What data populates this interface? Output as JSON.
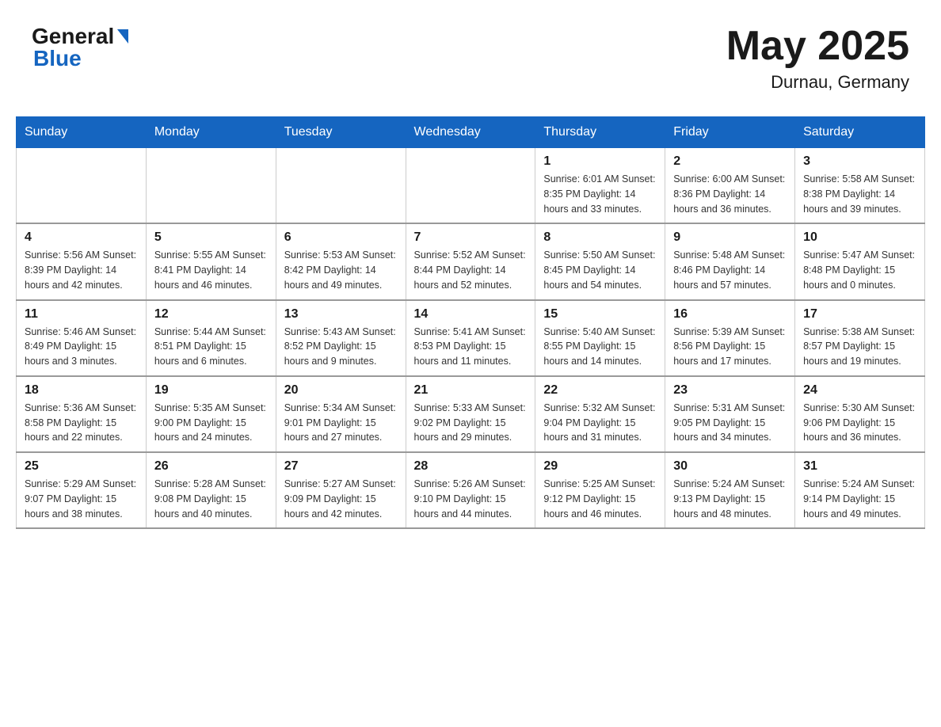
{
  "header": {
    "logo_general": "General",
    "logo_blue": "Blue",
    "month_year": "May 2025",
    "location": "Durnau, Germany"
  },
  "calendar": {
    "days_of_week": [
      "Sunday",
      "Monday",
      "Tuesday",
      "Wednesday",
      "Thursday",
      "Friday",
      "Saturday"
    ],
    "weeks": [
      [
        {
          "day": "",
          "info": ""
        },
        {
          "day": "",
          "info": ""
        },
        {
          "day": "",
          "info": ""
        },
        {
          "day": "",
          "info": ""
        },
        {
          "day": "1",
          "info": "Sunrise: 6:01 AM\nSunset: 8:35 PM\nDaylight: 14 hours and 33 minutes."
        },
        {
          "day": "2",
          "info": "Sunrise: 6:00 AM\nSunset: 8:36 PM\nDaylight: 14 hours and 36 minutes."
        },
        {
          "day": "3",
          "info": "Sunrise: 5:58 AM\nSunset: 8:38 PM\nDaylight: 14 hours and 39 minutes."
        }
      ],
      [
        {
          "day": "4",
          "info": "Sunrise: 5:56 AM\nSunset: 8:39 PM\nDaylight: 14 hours and 42 minutes."
        },
        {
          "day": "5",
          "info": "Sunrise: 5:55 AM\nSunset: 8:41 PM\nDaylight: 14 hours and 46 minutes."
        },
        {
          "day": "6",
          "info": "Sunrise: 5:53 AM\nSunset: 8:42 PM\nDaylight: 14 hours and 49 minutes."
        },
        {
          "day": "7",
          "info": "Sunrise: 5:52 AM\nSunset: 8:44 PM\nDaylight: 14 hours and 52 minutes."
        },
        {
          "day": "8",
          "info": "Sunrise: 5:50 AM\nSunset: 8:45 PM\nDaylight: 14 hours and 54 minutes."
        },
        {
          "day": "9",
          "info": "Sunrise: 5:48 AM\nSunset: 8:46 PM\nDaylight: 14 hours and 57 minutes."
        },
        {
          "day": "10",
          "info": "Sunrise: 5:47 AM\nSunset: 8:48 PM\nDaylight: 15 hours and 0 minutes."
        }
      ],
      [
        {
          "day": "11",
          "info": "Sunrise: 5:46 AM\nSunset: 8:49 PM\nDaylight: 15 hours and 3 minutes."
        },
        {
          "day": "12",
          "info": "Sunrise: 5:44 AM\nSunset: 8:51 PM\nDaylight: 15 hours and 6 minutes."
        },
        {
          "day": "13",
          "info": "Sunrise: 5:43 AM\nSunset: 8:52 PM\nDaylight: 15 hours and 9 minutes."
        },
        {
          "day": "14",
          "info": "Sunrise: 5:41 AM\nSunset: 8:53 PM\nDaylight: 15 hours and 11 minutes."
        },
        {
          "day": "15",
          "info": "Sunrise: 5:40 AM\nSunset: 8:55 PM\nDaylight: 15 hours and 14 minutes."
        },
        {
          "day": "16",
          "info": "Sunrise: 5:39 AM\nSunset: 8:56 PM\nDaylight: 15 hours and 17 minutes."
        },
        {
          "day": "17",
          "info": "Sunrise: 5:38 AM\nSunset: 8:57 PM\nDaylight: 15 hours and 19 minutes."
        }
      ],
      [
        {
          "day": "18",
          "info": "Sunrise: 5:36 AM\nSunset: 8:58 PM\nDaylight: 15 hours and 22 minutes."
        },
        {
          "day": "19",
          "info": "Sunrise: 5:35 AM\nSunset: 9:00 PM\nDaylight: 15 hours and 24 minutes."
        },
        {
          "day": "20",
          "info": "Sunrise: 5:34 AM\nSunset: 9:01 PM\nDaylight: 15 hours and 27 minutes."
        },
        {
          "day": "21",
          "info": "Sunrise: 5:33 AM\nSunset: 9:02 PM\nDaylight: 15 hours and 29 minutes."
        },
        {
          "day": "22",
          "info": "Sunrise: 5:32 AM\nSunset: 9:04 PM\nDaylight: 15 hours and 31 minutes."
        },
        {
          "day": "23",
          "info": "Sunrise: 5:31 AM\nSunset: 9:05 PM\nDaylight: 15 hours and 34 minutes."
        },
        {
          "day": "24",
          "info": "Sunrise: 5:30 AM\nSunset: 9:06 PM\nDaylight: 15 hours and 36 minutes."
        }
      ],
      [
        {
          "day": "25",
          "info": "Sunrise: 5:29 AM\nSunset: 9:07 PM\nDaylight: 15 hours and 38 minutes."
        },
        {
          "day": "26",
          "info": "Sunrise: 5:28 AM\nSunset: 9:08 PM\nDaylight: 15 hours and 40 minutes."
        },
        {
          "day": "27",
          "info": "Sunrise: 5:27 AM\nSunset: 9:09 PM\nDaylight: 15 hours and 42 minutes."
        },
        {
          "day": "28",
          "info": "Sunrise: 5:26 AM\nSunset: 9:10 PM\nDaylight: 15 hours and 44 minutes."
        },
        {
          "day": "29",
          "info": "Sunrise: 5:25 AM\nSunset: 9:12 PM\nDaylight: 15 hours and 46 minutes."
        },
        {
          "day": "30",
          "info": "Sunrise: 5:24 AM\nSunset: 9:13 PM\nDaylight: 15 hours and 48 minutes."
        },
        {
          "day": "31",
          "info": "Sunrise: 5:24 AM\nSunset: 9:14 PM\nDaylight: 15 hours and 49 minutes."
        }
      ]
    ]
  }
}
